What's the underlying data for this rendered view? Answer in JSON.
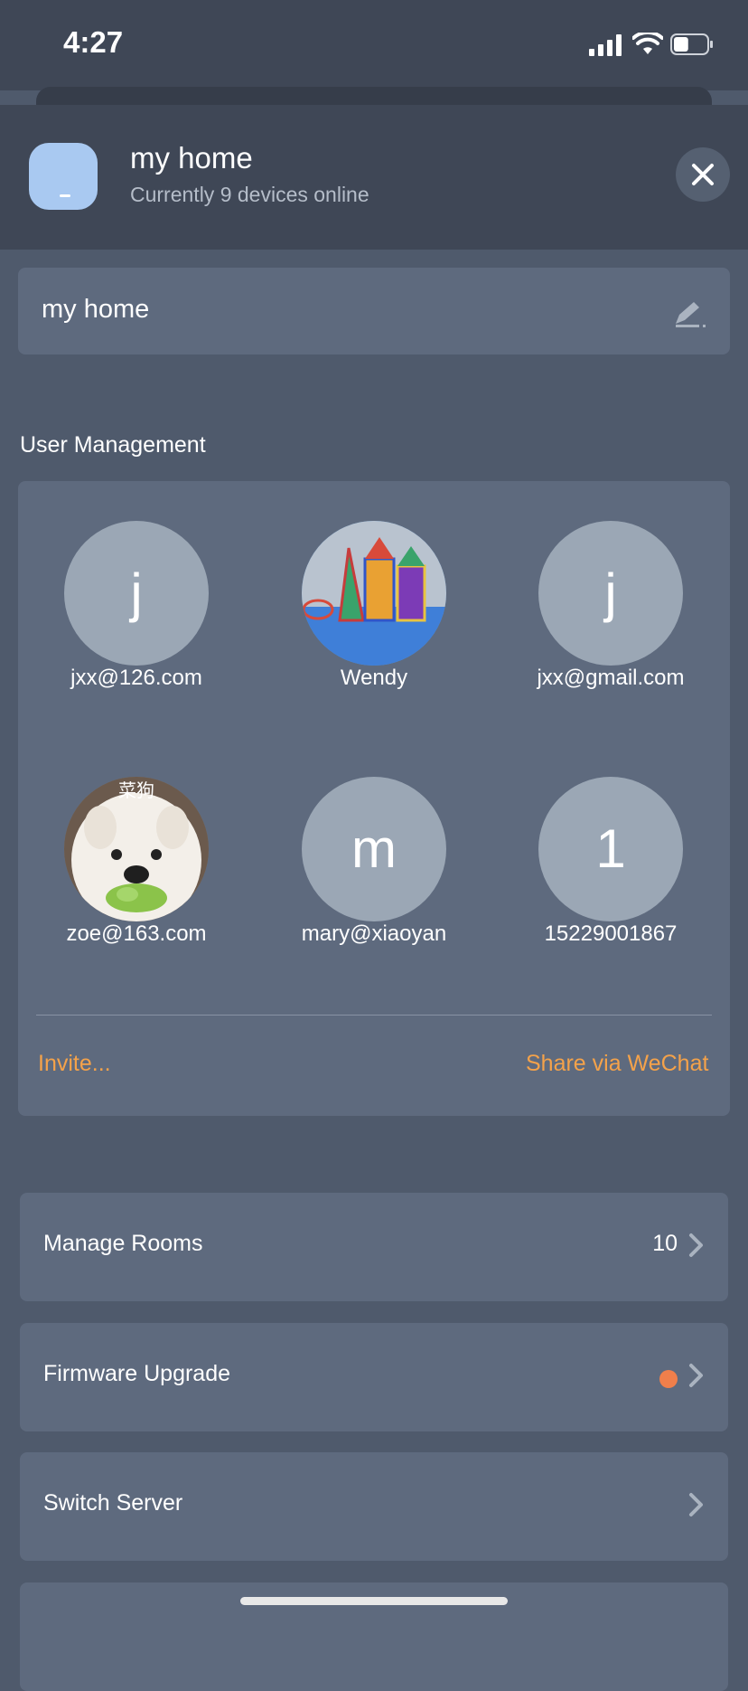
{
  "status_bar": {
    "time": "4:27",
    "battery_level": 0.45
  },
  "header": {
    "title": "my home",
    "subtitle": "Currently 9 devices online",
    "home_icon": "home-tile-icon",
    "close_icon": "close-icon"
  },
  "name_field": {
    "value": "my home",
    "edit_icon": "pencil-icon"
  },
  "users_section": {
    "label": "User Management",
    "users": [
      {
        "name": "jxx@126.com",
        "initial": "j",
        "avatar": "letter"
      },
      {
        "name": "Wendy",
        "initial": "",
        "avatar": "photo-magnetic-tiles"
      },
      {
        "name": "jxx@gmail.com",
        "initial": "j",
        "avatar": "letter"
      },
      {
        "name": "zoe@163.com",
        "initial": "",
        "avatar": "photo-dog",
        "avatar_caption": "菜狗"
      },
      {
        "name": "mary@xiaoyan",
        "initial": "m",
        "avatar": "letter"
      },
      {
        "name": "15229001867",
        "initial": "1",
        "avatar": "letter"
      }
    ],
    "invite_label": "Invite...",
    "share_label": "Share via WeChat"
  },
  "menu": [
    {
      "label": "Manage Rooms",
      "value": "10",
      "badge": false
    },
    {
      "label": "Firmware Upgrade",
      "value": "",
      "badge": true
    },
    {
      "label": "Switch Server",
      "value": "",
      "badge": false
    }
  ],
  "colors": {
    "background": "#4f5a6c",
    "header": "#3f4756",
    "card": "#5e6a7e",
    "accent_orange": "#f4a24a",
    "badge": "#f07f4b",
    "avatar": "#9ba7b5",
    "home_icon": "#a9c9f1"
  }
}
